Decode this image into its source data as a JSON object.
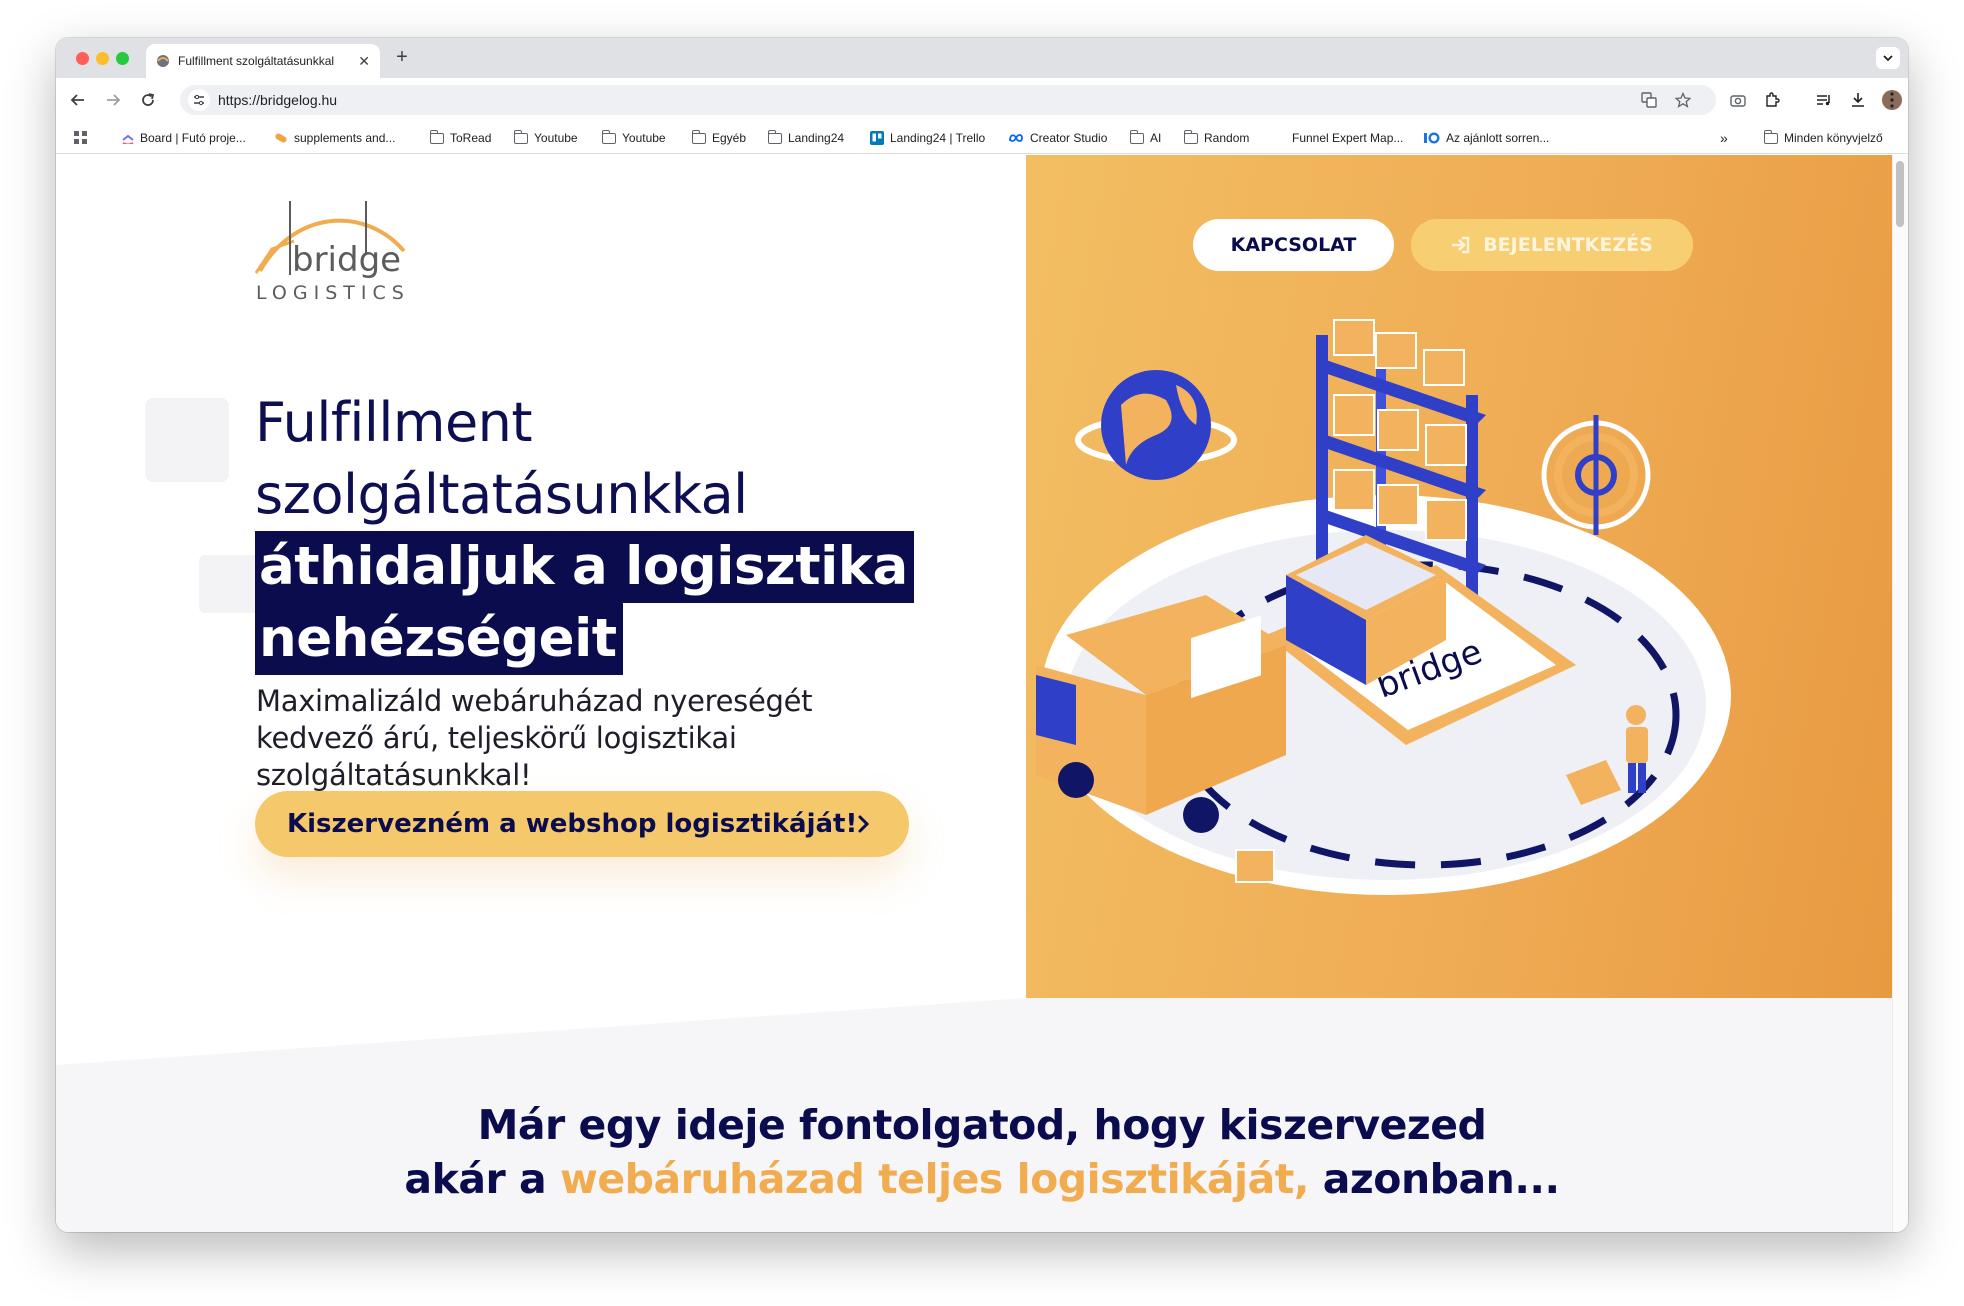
{
  "browser": {
    "tab_title": "Fulfillment szolgáltatásunkkal",
    "url": "https://bridgelog.hu",
    "bookmarks": [
      {
        "label": "Board | Futó proje...",
        "icon": "clickup-icon"
      },
      {
        "label": "supplements and...",
        "icon": "pill-icon"
      },
      {
        "label": "ToRead",
        "icon": "folder-icon"
      },
      {
        "label": "Youtube",
        "icon": "folder-icon"
      },
      {
        "label": "Youtube",
        "icon": "folder-icon"
      },
      {
        "label": "Egyéb",
        "icon": "folder-icon"
      },
      {
        "label": "Landing24",
        "icon": "folder-icon"
      },
      {
        "label": "Landing24 | Trello",
        "icon": "trello-icon"
      },
      {
        "label": "Creator Studio",
        "icon": "meta-icon"
      },
      {
        "label": "AI",
        "icon": "folder-icon"
      },
      {
        "label": "Random",
        "icon": "folder-icon"
      },
      {
        "label": "Funnel Expert Map...",
        "icon": "none"
      },
      {
        "label": "Az ajánlott sorren...",
        "icon": "io-icon"
      }
    ],
    "more_bookmarks": "»",
    "all_bookmarks": "Minden könyvjelző"
  },
  "logo": {
    "word1": "bridge",
    "word2": "LOGISTICS"
  },
  "nav": {
    "contact": "KAPCSOLAT",
    "login": "BEJELENTKEZÉS"
  },
  "hero": {
    "line1": "Fulfillment",
    "line2": "szolgáltatásunkkal",
    "highlight1": "áthidaljuk a logisztika",
    "highlight2": "nehézségeit",
    "subtitle": "Maximalizáld webáruházad nyereségét kedvező árú, teljeskörű logisztikai szolgáltatásunkkal!",
    "cta": "Kiszervezném a webshop logisztikáját!"
  },
  "section": {
    "line1": "Már egy ideje fontolgatod, hogy kiszervezed",
    "line2_pre": "akár a ",
    "line2_accent": "webáruházad teljes logisztikáját,",
    "line2_post": " azonban..."
  },
  "colors": {
    "navy": "#0b0c4d",
    "orange": "#efac55",
    "yellow": "#f5c96b",
    "blue": "#2f3fc8"
  }
}
